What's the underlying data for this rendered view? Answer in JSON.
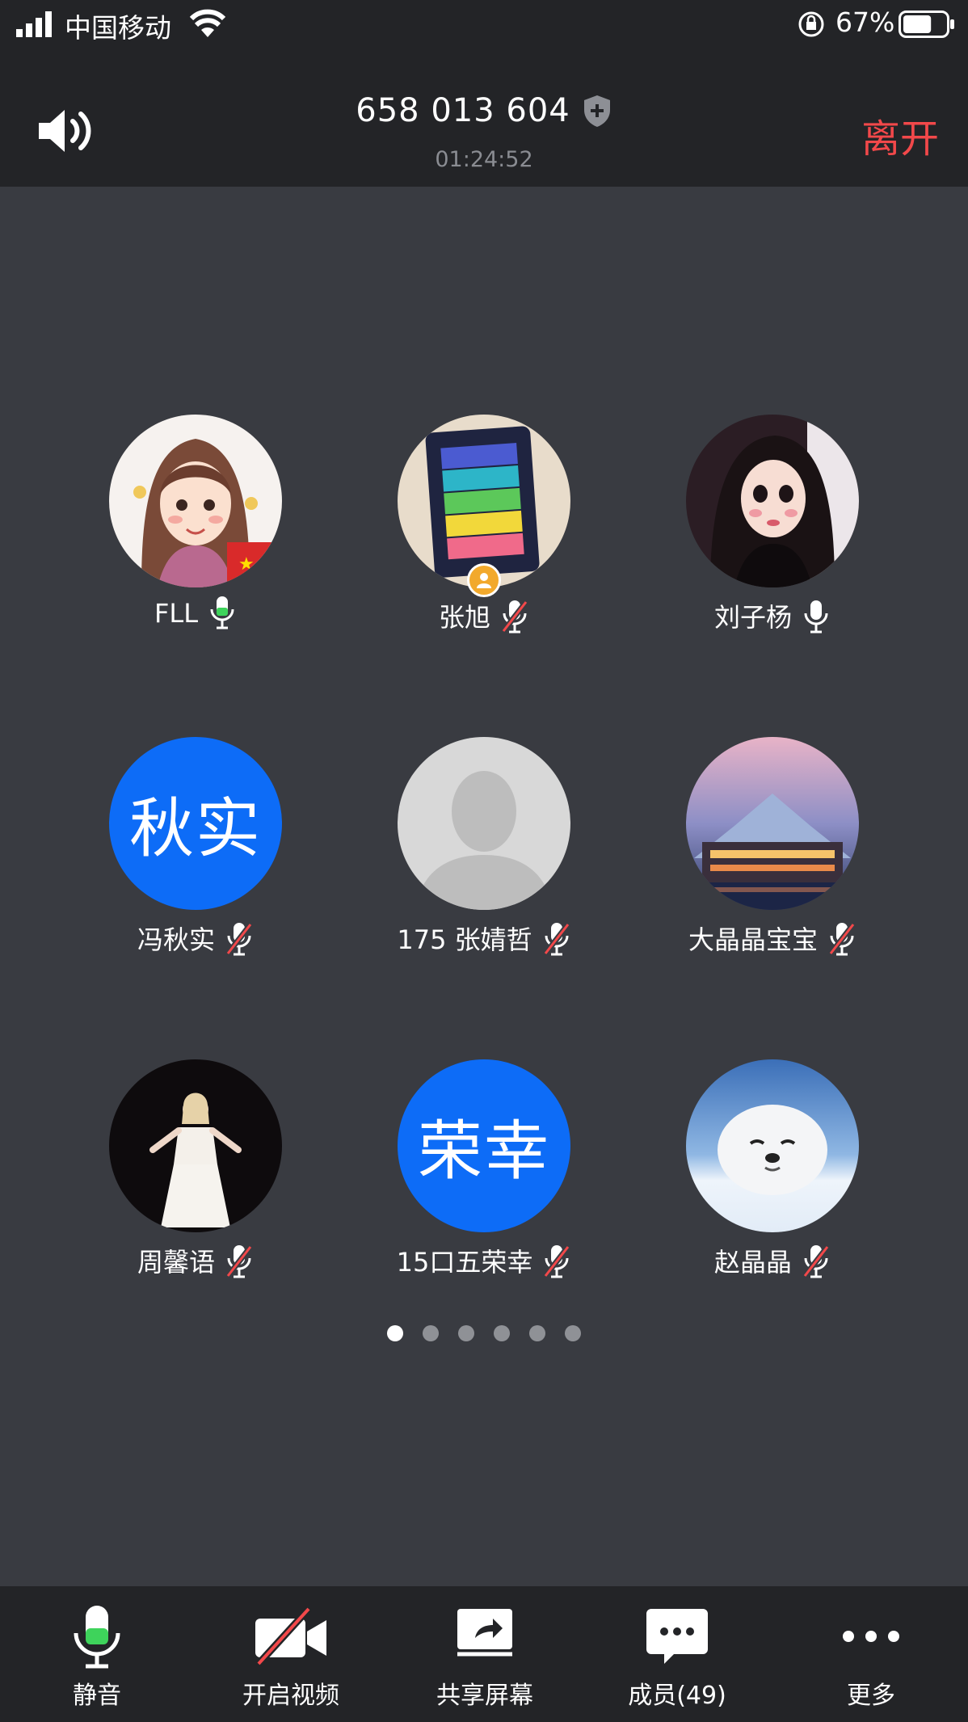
{
  "status_bar": {
    "carrier": "中国移动",
    "battery_percent": "67%",
    "battery_level": 0.67,
    "icons": [
      "signal-icon",
      "wifi-icon",
      "rotation-lock-icon",
      "battery-icon"
    ]
  },
  "header": {
    "meeting_id": "658 013 604",
    "duration": "01:24:52",
    "leave_label": "离开",
    "leave_color": "#f2484a"
  },
  "participants": [
    {
      "name": "FLL",
      "mic": "on",
      "avatar": "illustrated-girl"
    },
    {
      "name": "张旭",
      "mic": "off",
      "avatar": "sticky-notes-photo",
      "host": true
    },
    {
      "name": "刘子杨",
      "mic": "on",
      "avatar": "girl-photo"
    },
    {
      "name": "冯秋实",
      "mic": "off",
      "avatar_text": "秋实"
    },
    {
      "name": "175 张婧哲",
      "mic": "off",
      "avatar": "default-person"
    },
    {
      "name": "大晶晶宝宝",
      "mic": "off",
      "avatar": "building-photo"
    },
    {
      "name": "周馨语",
      "mic": "off",
      "avatar": "woman-in-white-photo"
    },
    {
      "name": "15口五荣幸",
      "mic": "off",
      "avatar_text": "荣幸"
    },
    {
      "name": "赵晶晶",
      "mic": "off",
      "avatar": "seal-photo"
    }
  ],
  "pagination": {
    "pages": 6,
    "current": 1
  },
  "toolbar": {
    "mute_label": "静音",
    "video_label": "开启视频",
    "share_label": "共享屏幕",
    "members_label": "成员(49)",
    "more_label": "更多"
  },
  "colors": {
    "background": "#393b41",
    "bar": "#232427",
    "text_avatar": "#0d6cf7",
    "mic_level": "#3ed35b"
  }
}
